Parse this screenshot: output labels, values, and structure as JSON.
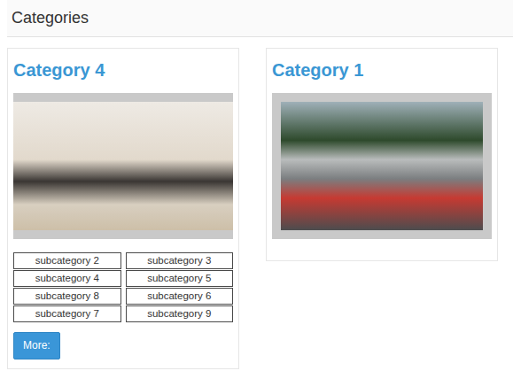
{
  "page_title": "Categories",
  "categories": [
    {
      "title": "Category 4",
      "subcategories": [
        "subcategory 2",
        "subcategory 3",
        "subcategory 4",
        "subcategory 5",
        "subcategory 8",
        "subcategory 6",
        "subcategory 7",
        "subcategory 9"
      ],
      "more": "More:"
    },
    {
      "title": "Category 1",
      "subcategories": [],
      "more": null
    }
  ]
}
